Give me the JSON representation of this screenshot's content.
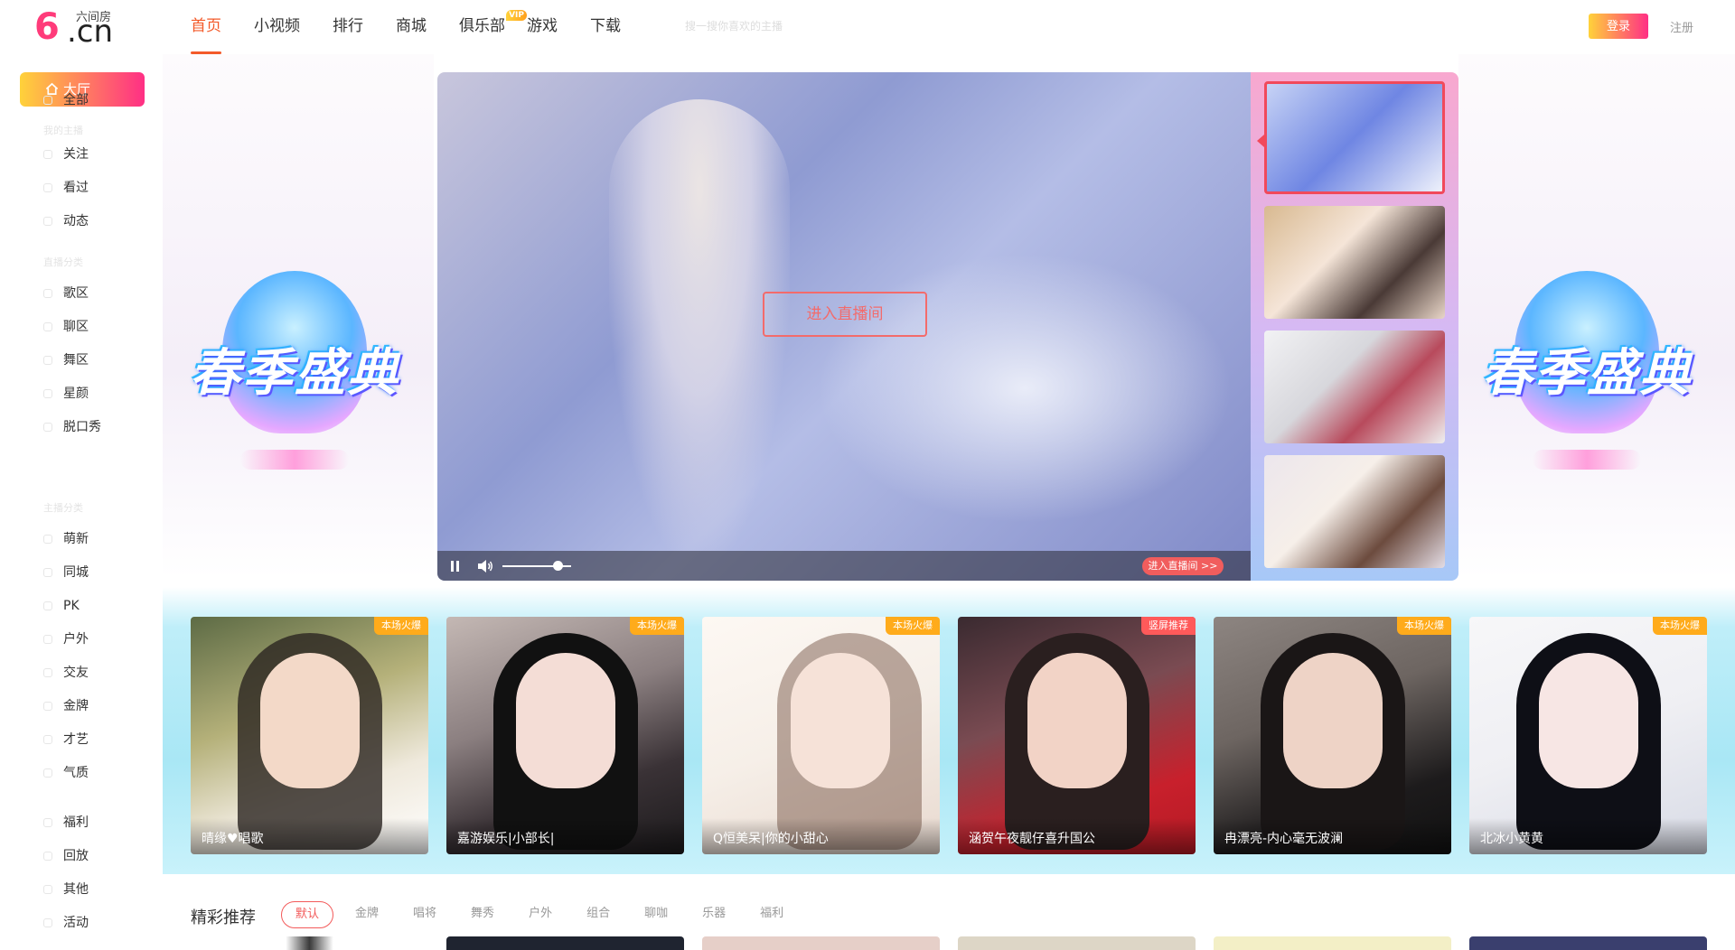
{
  "header": {
    "logo_mark": "6",
    "logo_domain": ".cn",
    "logo_brand": "六间房",
    "nav": [
      {
        "label": "首页",
        "active": true
      },
      {
        "label": "小视频"
      },
      {
        "label": "排行"
      },
      {
        "label": "商城"
      },
      {
        "label": "俱乐部",
        "badge": "VIP"
      },
      {
        "label": "游戏"
      },
      {
        "label": "下载"
      }
    ],
    "search_hint": "搜一搜你喜欢的主播",
    "login_label": "登录",
    "register_label": "注册"
  },
  "sidebar": {
    "active_label": "大厅",
    "items": [
      {
        "label": "全部"
      },
      {
        "label": "关注"
      },
      {
        "label": "看过"
      },
      {
        "label": "动态"
      },
      {
        "label": "歌区"
      },
      {
        "label": "聊区"
      },
      {
        "label": "舞区"
      },
      {
        "label": "星颜"
      },
      {
        "label": "脱口秀"
      },
      {
        "label": "萌新"
      },
      {
        "label": "同城"
      },
      {
        "label": "PK"
      },
      {
        "label": "户外"
      },
      {
        "label": "交友"
      },
      {
        "label": "金牌"
      },
      {
        "label": "才艺"
      },
      {
        "label": "气质"
      },
      {
        "label": "福利"
      },
      {
        "label": "回放"
      },
      {
        "label": "其他"
      },
      {
        "label": "活动"
      }
    ],
    "groups": [
      "我的主播",
      "直播分类",
      "主播分类"
    ]
  },
  "banner": {
    "event_title": "春季盛典"
  },
  "player": {
    "enter_label": "进入直播间",
    "enter_small_label": "进入直播间 >>",
    "volume_level": 0.8
  },
  "live_cards": [
    {
      "badge": "本场火爆",
      "name": "晴缘♥唱歌"
    },
    {
      "badge": "本场火爆",
      "name": "嘉游娱乐|小部长|"
    },
    {
      "badge": "本场火爆",
      "name": "Q恒美呆|你的小甜心"
    },
    {
      "badge": "竖屏推荐",
      "name": "涵贺午夜靓仔喜升国公"
    },
    {
      "badge": "本场火爆",
      "name": "冉漂亮-内心毫无波澜"
    },
    {
      "badge": "本场火爆",
      "name": "北冰小黄黄"
    }
  ],
  "recommend": {
    "title": "精彩推荐",
    "tabs": [
      {
        "label": "默认",
        "active": true
      },
      {
        "label": "金牌"
      },
      {
        "label": "唱将"
      },
      {
        "label": "舞秀"
      },
      {
        "label": "户外"
      },
      {
        "label": "组合"
      },
      {
        "label": "聊咖"
      },
      {
        "label": "乐器"
      },
      {
        "label": "福利"
      }
    ]
  },
  "colors": {
    "accent": "#f35a2a",
    "gradient_start": "#ffd23a",
    "gradient_end": "#ff2f85",
    "badge_orange": "#ffab1b",
    "badge_red": "#ff5a5a",
    "enter_red": "#f15d5d"
  },
  "icons": {
    "home": "home-icon",
    "pause": "pause-icon",
    "volume": "volume-icon"
  }
}
